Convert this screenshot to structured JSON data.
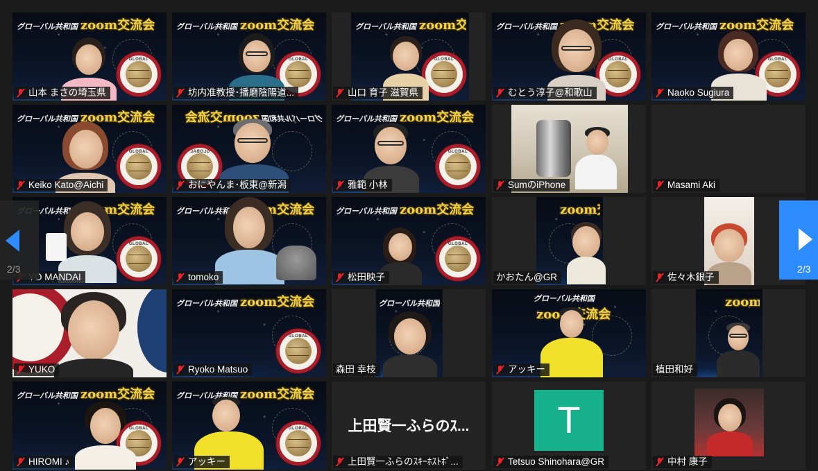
{
  "gallery": {
    "page_indicator_left": "2/3",
    "page_indicator_right": "2/3"
  },
  "background_banner": {
    "small_title": "グローバル共和国",
    "big_title": "zoom交流会",
    "subtitle": "〜 世界を変える 〜",
    "logo_text": "GLOBAL"
  },
  "participants": [
    {
      "name": "山本 まさの埼玉県"
    },
    {
      "name": "坊内准教授･播磨陰陽道..."
    },
    {
      "name": "山口 育子 滋賀県"
    },
    {
      "name": "むとう淳子@和歌山"
    },
    {
      "name": "Naoko Sugiura"
    },
    {
      "name": "Keiko Kato@Aichi"
    },
    {
      "name": "おにやんま･板東@新潟"
    },
    {
      "name": "雅範 小林"
    },
    {
      "name": "SumのiPhone"
    },
    {
      "name": "Masami Aki"
    },
    {
      "name": "YO MANDAI"
    },
    {
      "name": "tomoko"
    },
    {
      "name": "松田映子"
    },
    {
      "name": "かおたん@GR"
    },
    {
      "name": "佐々木銀子"
    },
    {
      "name": "YUKO"
    },
    {
      "name": "Ryoko Matsuo"
    },
    {
      "name": "森田 幸枝"
    },
    {
      "name": "アッキー"
    },
    {
      "name": "植田和好"
    },
    {
      "name": "HIROMI ♪"
    },
    {
      "name": "アッキー"
    },
    {
      "name": "上田賢一ふらのｽｷｰﾎｽﾄﾎﾞ..."
    },
    {
      "name": "Tetsuo Shinohara@GR"
    },
    {
      "name": "中村 康子"
    }
  ],
  "video_off_tiles": {
    "ueda_display_name": "上田賢一ふらのｽ...",
    "shinohara_avatar_initial": "T"
  },
  "colors": {
    "zoom_blue": "#2d8cff",
    "muted_red": "#e8252a",
    "banner_gold": "#f3d24a",
    "avatar_green": "#17b28c"
  }
}
